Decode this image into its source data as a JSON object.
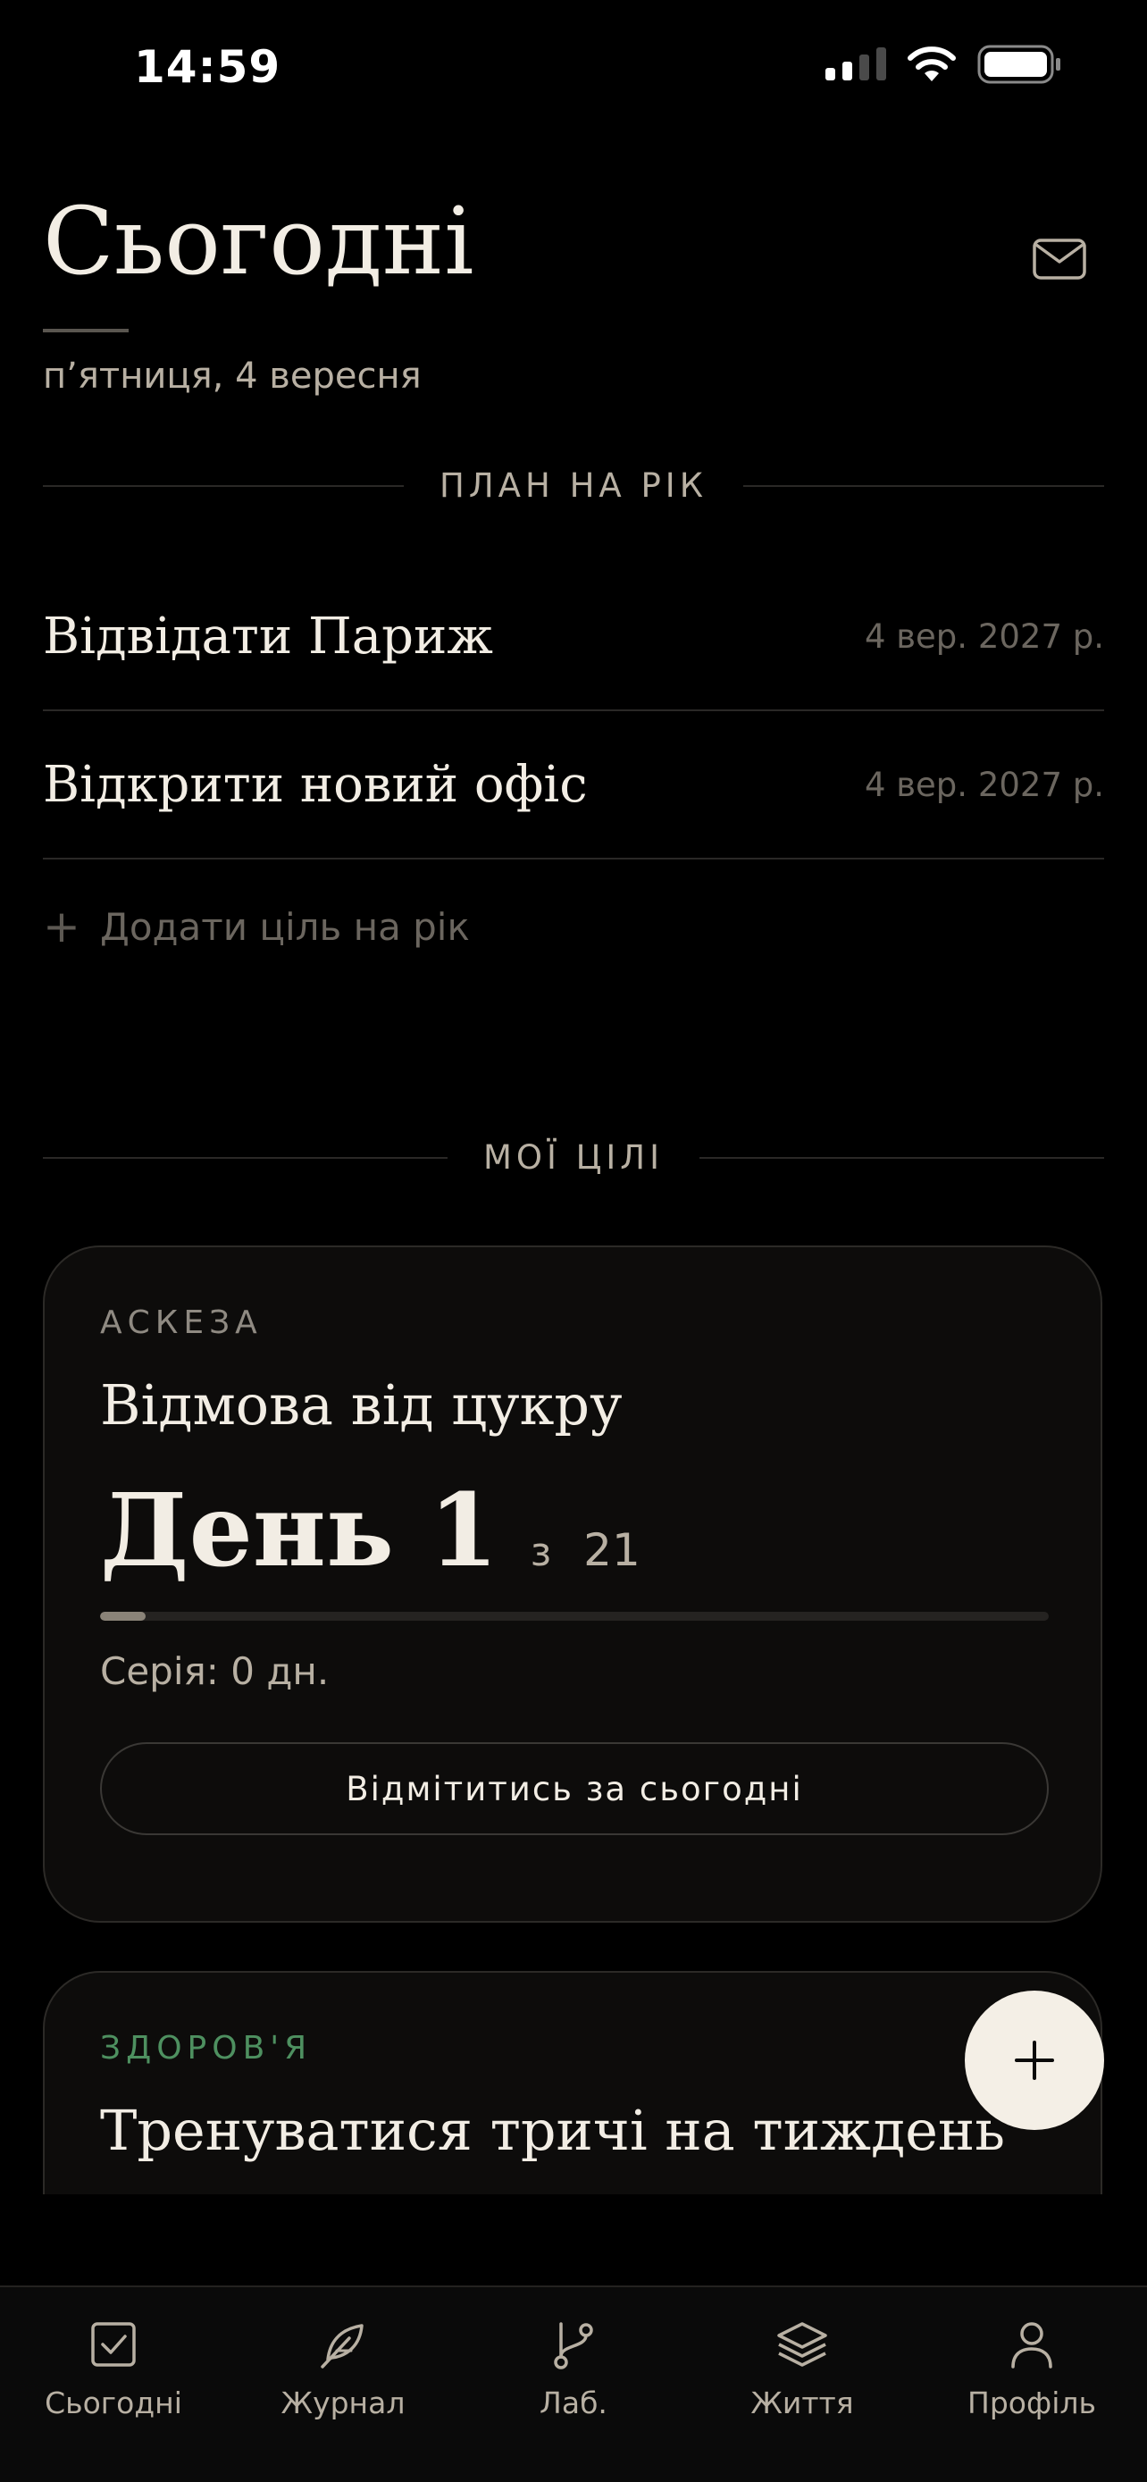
{
  "status_bar": {
    "time": "14:59"
  },
  "header": {
    "title": "Сьогодні",
    "date": "п’ятниця, 4 вересня"
  },
  "year_plan": {
    "section_label": "ПЛАН НА РІК",
    "items": [
      {
        "title": "Відвідати Париж",
        "date": "4 вер. 2027 р."
      },
      {
        "title": "Відкрити новий офіс",
        "date": "4 вер. 2027 р."
      }
    ],
    "add_label": "Додати ціль на рік"
  },
  "goals": {
    "section_label": "МОЇ ЦІЛІ",
    "cards": [
      {
        "category": "АСКЕЗА",
        "title": "Відмова від цукру",
        "day_label": "День 1",
        "day_of": "з",
        "day_total": "21",
        "progress": 0.048,
        "streak": "Серія: 0 дн.",
        "checkin_label": "Відмітитись за сьогодні",
        "category_color": "#8f8a82"
      },
      {
        "category": "ЗДОРОВ'Я",
        "title": "Тренуватися тричі на тиждень",
        "category_color": "#4e9060"
      }
    ]
  },
  "tabs": [
    {
      "label": "Сьогодні",
      "icon": "checkbox-icon"
    },
    {
      "label": "Журнал",
      "icon": "feather-icon"
    },
    {
      "label": "Лаб.",
      "icon": "branch-icon"
    },
    {
      "label": "Життя",
      "icon": "layers-icon"
    },
    {
      "label": "Профіль",
      "icon": "user-icon"
    }
  ],
  "colors": {
    "background": "#000000",
    "text_primary": "#f2ede4",
    "text_secondary": "#b8b0a3",
    "fab": "#f4efe6",
    "health_accent": "#4e9060"
  }
}
